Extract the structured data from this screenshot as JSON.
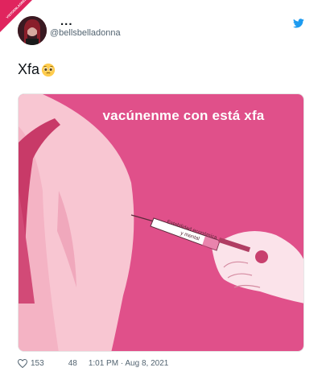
{
  "user": {
    "display_name": "...",
    "handle": "@bellsbelladonna"
  },
  "watermark": {
    "text": "VISTOENLASREDES"
  },
  "tweet": {
    "text": "Xfa",
    "emoji": "pleading-face"
  },
  "meme": {
    "caption": "vacúnenme con está xfa",
    "syringe_label": "Estabilidad económica y mental"
  },
  "footer": {
    "likes": "153",
    "retweets": "48",
    "timestamp": "1:01 PM · Aug 8, 2021"
  },
  "colors": {
    "twitter_blue": "#1d9bf0",
    "meme_background": "#e0508a",
    "skin": "#f8c6d2"
  }
}
